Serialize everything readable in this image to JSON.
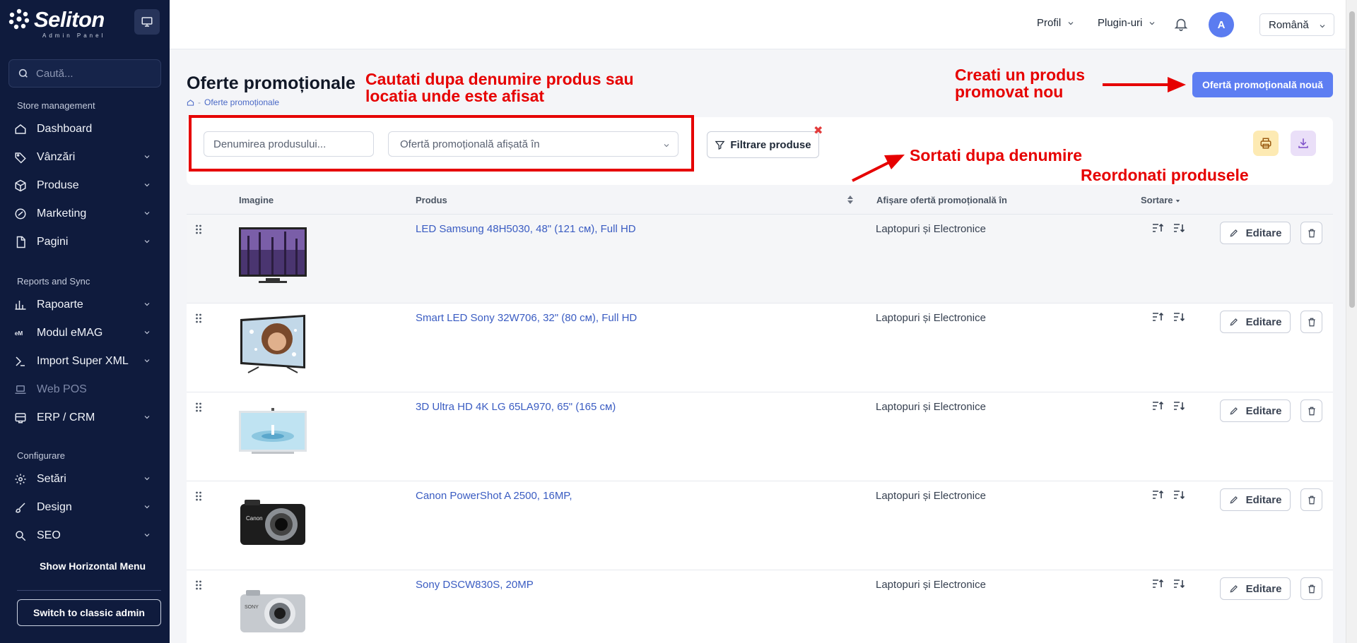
{
  "sidebar": {
    "brand_name": "Seliton",
    "brand_sub": "Admin Panel",
    "search_placeholder": "Caută...",
    "sections": {
      "store": "Store management",
      "reports": "Reports and Sync",
      "config": "Configurare"
    },
    "items": [
      {
        "label": "Dashboard",
        "icon": "home-icon",
        "chevron": false
      },
      {
        "label": "Vânzări",
        "icon": "tag-icon",
        "chevron": true
      },
      {
        "label": "Produse",
        "icon": "box-icon",
        "chevron": true
      },
      {
        "label": "Marketing",
        "icon": "marketing-icon",
        "chevron": true
      },
      {
        "label": "Pagini",
        "icon": "file-icon",
        "chevron": true
      },
      {
        "label": "Rapoarte",
        "icon": "chart-icon",
        "chevron": true
      },
      {
        "label": "Modul eMAG",
        "icon": "emag-icon",
        "chevron": true
      },
      {
        "label": "Import Super XML",
        "icon": "import-icon",
        "chevron": true
      },
      {
        "label": "Web POS",
        "icon": "laptop-icon",
        "chevron": false
      },
      {
        "label": "ERP / CRM",
        "icon": "crm-icon",
        "chevron": true
      },
      {
        "label": "Setări",
        "icon": "gear-icon",
        "chevron": true
      },
      {
        "label": "Design",
        "icon": "brush-icon",
        "chevron": true
      },
      {
        "label": "SEO",
        "icon": "seo-icon",
        "chevron": true
      }
    ],
    "show_horizontal_menu": "Show Horizontal Menu",
    "switch_classic": "Switch to classic admin"
  },
  "topbar": {
    "profile": "Profil",
    "plugins": "Plugin-uri",
    "avatar_letter": "A",
    "language": "Română"
  },
  "page": {
    "title": "Oferte promoționale",
    "breadcrumb": "Oferte promoționale",
    "new_button": "Ofertă promoțională nouă"
  },
  "filters": {
    "name_placeholder": "Denumirea produsului...",
    "location_placeholder": "Ofertă promoțională afișată în",
    "filter_button": "Filtrare produse",
    "clear_symbol": "✖"
  },
  "annotations": {
    "search_hint_line1": "Cautati dupa denumire produs sau",
    "search_hint_line2": "locatia unde este afisat",
    "create_hint_line1": "Creati un produs",
    "create_hint_line2": "promovat nou",
    "sort_hint": "Sortati dupa denumire",
    "reorder_hint": "Reordonati produsele",
    "color": "#e60000"
  },
  "table": {
    "headers": {
      "image": "Imagine",
      "product": "Produs",
      "location": "Afișare ofertă promoțională în",
      "sort": "Sortare"
    },
    "edit_label": "Editare",
    "rows": [
      {
        "product": "LED Samsung 48H5030, 48\" (121 см), Full HD",
        "location": "Laptopuri și Electronice",
        "thumb": "tv-forest"
      },
      {
        "product": "Smart LED Sony 32W706, 32\" (80 см), Full HD",
        "location": "Laptopuri și Electronice",
        "thumb": "tv-portrait"
      },
      {
        "product": "3D Ultra HD 4K LG 65LA970, 65\" (165 см)",
        "location": "Laptopuri și Electronice",
        "thumb": "tv-water"
      },
      {
        "product": "Canon PowerShot A 2500, 16MP,",
        "location": "Laptopuri și Electronice",
        "thumb": "camera-black"
      },
      {
        "product": "Sony DSCW830S, 20MP",
        "location": "Laptopuri și Electronice",
        "thumb": "camera-silver"
      }
    ]
  },
  "colors": {
    "sidebar_bg": "#0f1b3d",
    "accent": "#5d7ef2",
    "link": "#3a5cc2"
  }
}
